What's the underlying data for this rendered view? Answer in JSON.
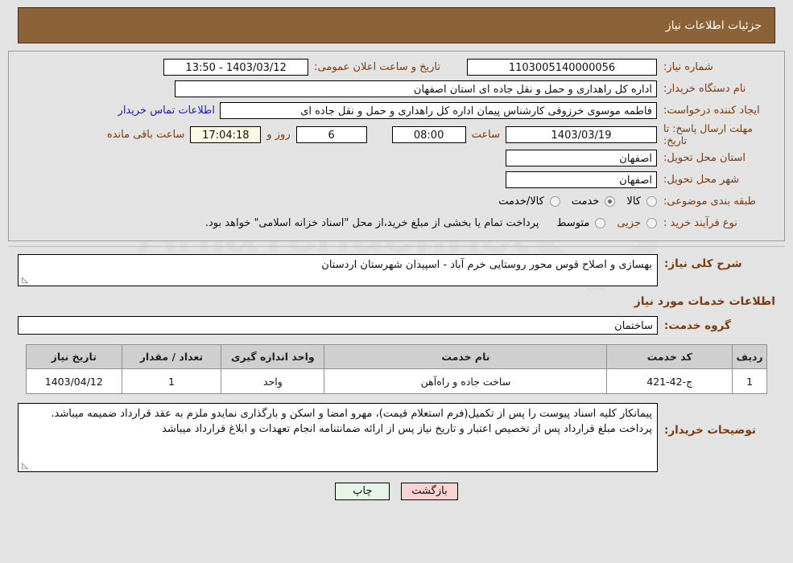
{
  "header": {
    "title": "جزئیات اطلاعات نیاز"
  },
  "form": {
    "need_number_label": "شماره نیاز:",
    "need_number_value": "1103005140000056",
    "announce_datetime_label": "تاریخ و ساعت اعلان عمومی:",
    "announce_datetime_value": "1403/03/12 - 13:50",
    "buyer_org_label": "نام دستگاه خریدار:",
    "buyer_org_value": "اداره کل راهداری و حمل و نقل جاده ای استان اصفهان",
    "requester_label": "ایجاد کننده درخواست:",
    "requester_value": "فاطمه موسوی خرزوقی کارشناس پیمان اداره کل راهداری و حمل و نقل جاده ای",
    "buyer_contact_link": "اطلاعات تماس خریدار",
    "deadline_label": "مهلت ارسال پاسخ: تا تاریخ:",
    "deadline_date": "1403/03/19",
    "hour_label": "ساعت",
    "hour_value": "08:00",
    "days_value": "6",
    "days_label": "روز و",
    "countdown_value": "17:04:18",
    "countdown_label": "ساعت باقی مانده",
    "province_label": "استان محل تحویل:",
    "province_value": "اصفهان",
    "city_label": "شهر محل تحویل:",
    "city_value": "اصفهان",
    "category_label": "طبقه بندی موضوعی:",
    "category_options": [
      {
        "label": "کالا",
        "selected": false
      },
      {
        "label": "خدمت",
        "selected": true
      },
      {
        "label": "کالا/خدمت",
        "selected": false
      }
    ],
    "process_type_label": "نوع فرآیند خرید :",
    "process_options": [
      {
        "label": "جزیی",
        "selected": false
      },
      {
        "label": "متوسط",
        "selected": false
      }
    ],
    "payment_note": "پرداخت تمام یا بخشی از مبلغ خرید،از محل \"اسناد خزانه اسلامی\" خواهد بود."
  },
  "summary": {
    "label": "شرح کلی نیاز:",
    "value": "بهسازی و اصلاح قوس محور روستایی خرم آباد - اسپیدان شهرستان اردستان"
  },
  "services": {
    "section_title": "اطلاعات خدمات مورد نیاز",
    "group_label": "گروه خدمت:",
    "group_value": "ساختمان",
    "table": {
      "columns": [
        "ردیف",
        "کد خدمت",
        "نام خدمت",
        "واحد اندازه گیری",
        "تعداد / مقدار",
        "تاریخ نیاز"
      ],
      "rows": [
        [
          "1",
          "ج-42-421",
          "ساخت جاده و راه‌آهن",
          "واحد",
          "1",
          "1403/04/12"
        ]
      ]
    }
  },
  "buyer_notes": {
    "label": "توضیحات خریدار:",
    "value": "پیمانکار کلیه اسناد پیوست را پس از تکمیل(فرم استعلام قیمت)، مهرو امضا و اسکن و بارگذاری نمایدو ملزم به عقد قرارداد ضمیمه میباشد. پرداخت مبلغ قرارداد پس از تخصیص اعتبار و تاریخ نیاز پس از ارائه ضمانتنامه انجام تعهدات و ابلاغ قرارداد میباشد"
  },
  "buttons": {
    "print": "چاپ",
    "back": "بازگشت"
  },
  "watermark": {
    "text": "AniaTender.net"
  },
  "colors": {
    "header_bg": "#8c6239",
    "label_brown": "#7a3b10",
    "link_blue": "#1b1bc4",
    "print_btn": "#e6f5e6",
    "back_btn": "#fbd3d3",
    "countdown_bg": "#fbf8e3"
  }
}
